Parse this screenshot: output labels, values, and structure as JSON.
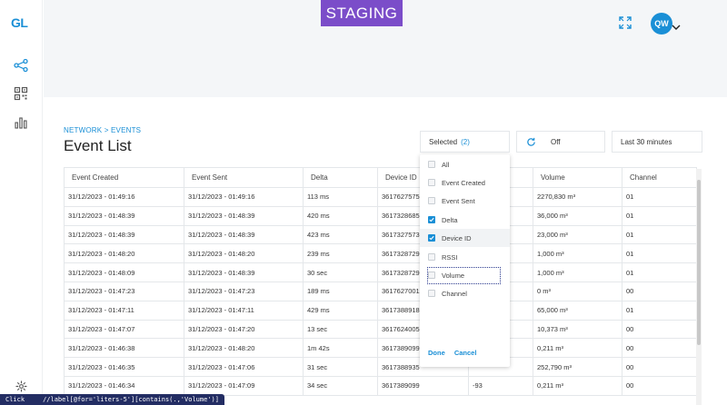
{
  "app": {
    "logo": "GL",
    "env_badge": "STAGING",
    "user_initials": "QW"
  },
  "colors": {
    "accent": "#1a8fd6",
    "badge": "#7b4dc9",
    "statusbar": "#232d63"
  },
  "sidebar": {
    "icons": [
      "network-icon",
      "qr-code-icon",
      "bar-chart-icon",
      "settings-icon"
    ]
  },
  "breadcrumb": "NETWORK > EVENTS",
  "page_title": "Event List",
  "controls": {
    "columns_label": "Selected",
    "columns_count": "(2)",
    "auto_refresh": "Off",
    "time_range": "Last 30 minutes"
  },
  "column_menu": {
    "options": [
      {
        "label": "All",
        "checked": false
      },
      {
        "label": "Event Created",
        "checked": false
      },
      {
        "label": "Event Sent",
        "checked": false
      },
      {
        "label": "Delta",
        "checked": true
      },
      {
        "label": "Device ID",
        "checked": true
      },
      {
        "label": "RSSI",
        "checked": false
      },
      {
        "label": "Volume",
        "checked": false
      },
      {
        "label": "Channel",
        "checked": false
      }
    ],
    "done": "Done",
    "cancel": "Cancel"
  },
  "table": {
    "headers": [
      "Event Created",
      "Event Sent",
      "Delta",
      "Device ID",
      "",
      "Volume",
      "Channel"
    ],
    "rows": [
      [
        "31/12/2023 - 01:49:16",
        "31/12/2023 - 01:49:16",
        "113 ms",
        "3617627575",
        "",
        "2270,830 m³",
        "01"
      ],
      [
        "31/12/2023 - 01:48:39",
        "31/12/2023 - 01:48:39",
        "420 ms",
        "3617328685",
        "",
        "36,000 m³",
        "01"
      ],
      [
        "31/12/2023 - 01:48:39",
        "31/12/2023 - 01:48:39",
        "423 ms",
        "3617327573",
        "",
        "23,000 m³",
        "01"
      ],
      [
        "31/12/2023 - 01:48:20",
        "31/12/2023 - 01:48:20",
        "239 ms",
        "3617328729",
        "",
        "1,000 m³",
        "01"
      ],
      [
        "31/12/2023 - 01:48:09",
        "31/12/2023 - 01:48:39",
        "30 sec",
        "3617328729",
        "",
        "1,000 m³",
        "01"
      ],
      [
        "31/12/2023 - 01:47:23",
        "31/12/2023 - 01:47:23",
        "189 ms",
        "3617627001",
        "",
        "0 m³",
        "00"
      ],
      [
        "31/12/2023 - 01:47:11",
        "31/12/2023 - 01:47:11",
        "429 ms",
        "3617388918",
        "",
        "65,000 m³",
        "01"
      ],
      [
        "31/12/2023 - 01:47:07",
        "31/12/2023 - 01:47:20",
        "13 sec",
        "3617624005",
        "",
        "10,373 m³",
        "00"
      ],
      [
        "31/12/2023 - 01:46:38",
        "31/12/2023 - 01:48:20",
        "1m 42s",
        "3617389099",
        "",
        "0,211 m³",
        "00"
      ],
      [
        "31/12/2023 - 01:46:35",
        "31/12/2023 - 01:47:06",
        "31 sec",
        "3617388935",
        "",
        "252,790 m³",
        "00"
      ],
      [
        "31/12/2023 - 01:46:34",
        "31/12/2023 - 01:47:09",
        "34 sec",
        "3617389099",
        "-93",
        "0,211 m³",
        "00"
      ]
    ]
  },
  "statusbar": {
    "action": "Click",
    "xpath": "//label[@for='liters-5'][contains(.,'Volume')]"
  }
}
